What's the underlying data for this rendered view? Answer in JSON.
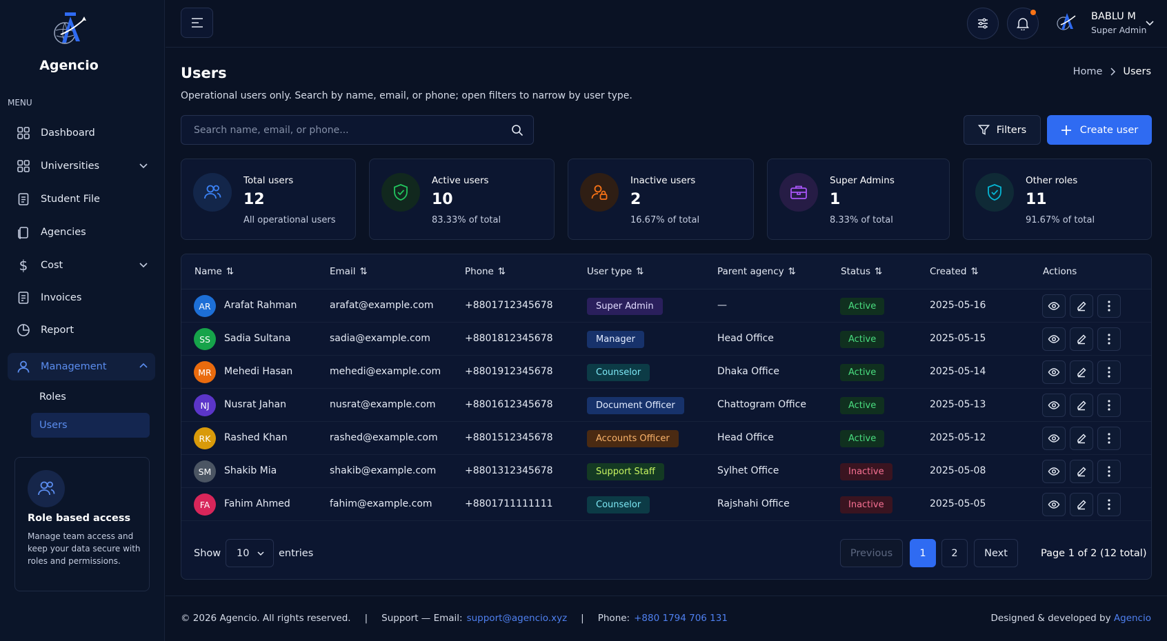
{
  "brand": {
    "name": "Agencio"
  },
  "sidebar": {
    "menu_title": "MENU",
    "items": [
      {
        "label": "Dashboard"
      },
      {
        "label": "Universities"
      },
      {
        "label": "Student File"
      },
      {
        "label": "Agencies"
      },
      {
        "label": "Cost"
      },
      {
        "label": "Invoices"
      },
      {
        "label": "Report"
      },
      {
        "label": "Management"
      }
    ],
    "sub_items": [
      {
        "label": "Roles"
      },
      {
        "label": "Users"
      }
    ],
    "promo": {
      "title": "Role based access",
      "text": "Manage team access and keep your data secure with roles and permissions."
    }
  },
  "topbar": {
    "user_name": "BABLU M",
    "user_role": "Super Admin"
  },
  "page": {
    "title": "Users",
    "subtitle": "Operational users only. Search by name, email, or phone; open filters to narrow by user type.",
    "breadcrumb": {
      "home": "Home",
      "current": "Users"
    }
  },
  "toolbar": {
    "search_placeholder": "Search name, email, or phone...",
    "filters_label": "Filters",
    "create_label": "Create user"
  },
  "stats": [
    {
      "label": "Total users",
      "value": "12",
      "sub": "All operational users",
      "color": "#3b82f6"
    },
    {
      "label": "Active users",
      "value": "10",
      "sub": "83.33% of total",
      "color": "#22c55e"
    },
    {
      "label": "Inactive users",
      "value": "2",
      "sub": "16.67% of total",
      "color": "#f97316"
    },
    {
      "label": "Super Admins",
      "value": "1",
      "sub": "8.33% of total",
      "color": "#a855f7"
    },
    {
      "label": "Other roles",
      "value": "11",
      "sub": "91.67% of total",
      "color": "#06b6d4"
    }
  ],
  "table": {
    "columns": [
      "Name",
      "Email",
      "Phone",
      "User type",
      "Parent agency",
      "Status",
      "Created",
      "Actions"
    ],
    "rows": [
      {
        "initials": "AR",
        "avatar_color": "#1d6fd6",
        "name": "Arafat Rahman",
        "email": "arafat@example.com",
        "phone": "+8801712345678",
        "type": "Super Admin",
        "type_style": "purple",
        "agency": "—",
        "status": "Active",
        "created": "2025-05-16"
      },
      {
        "initials": "SS",
        "avatar_color": "#16a34a",
        "name": "Sadia Sultana",
        "email": "sadia@example.com",
        "phone": "+8801812345678",
        "type": "Manager",
        "type_style": "blue",
        "agency": "Head Office",
        "status": "Active",
        "created": "2025-05-15"
      },
      {
        "initials": "MR",
        "avatar_color": "#ea6b0e",
        "name": "Mehedi Hasan",
        "email": "mehedi@example.com",
        "phone": "+8801912345678",
        "type": "Counselor",
        "type_style": "teal",
        "agency": "Dhaka Office",
        "status": "Active",
        "created": "2025-05-14"
      },
      {
        "initials": "NJ",
        "avatar_color": "#5b35c9",
        "name": "Nusrat Jahan",
        "email": "nusrat@example.com",
        "phone": "+8801612345678",
        "type": "Document Officer",
        "type_style": "blue",
        "agency": "Chattogram Office",
        "status": "Active",
        "created": "2025-05-13"
      },
      {
        "initials": "RK",
        "avatar_color": "#d99a0a",
        "name": "Rashed Khan",
        "email": "rashed@example.com",
        "phone": "+8801512345678",
        "type": "Accounts Officer",
        "type_style": "orange",
        "agency": "Head Office",
        "status": "Active",
        "created": "2025-05-12"
      },
      {
        "initials": "SM",
        "avatar_color": "#4b5563",
        "name": "Shakib Mia",
        "email": "shakib@example.com",
        "phone": "+8801312345678",
        "type": "Support Staff",
        "type_style": "green",
        "agency": "Sylhet Office",
        "status": "Inactive",
        "created": "2025-05-08"
      },
      {
        "initials": "FA",
        "avatar_color": "#d8265a",
        "name": "Fahim Ahmed",
        "email": "fahim@example.com",
        "phone": "+8801711111111",
        "type": "Counselor",
        "type_style": "teal",
        "agency": "Rajshahi Office",
        "status": "Inactive",
        "created": "2025-05-05"
      }
    ]
  },
  "pagination": {
    "show_label": "Show",
    "page_size": "10",
    "entries_label": "entries",
    "previous": "Previous",
    "pages": [
      "1",
      "2"
    ],
    "next": "Next",
    "info": "Page 1 of 2 (12 total)"
  },
  "footer": {
    "copyright": "© 2026 Agencio. All rights reserved.",
    "separator": "|",
    "support_prefix": "Support — Email:",
    "support_email": "support@agencio.xyz",
    "phone_prefix": "Phone:",
    "phone": "+880 1794 706 131",
    "credit_prefix": "Designed & developed by",
    "credit_link": "Agencio"
  }
}
